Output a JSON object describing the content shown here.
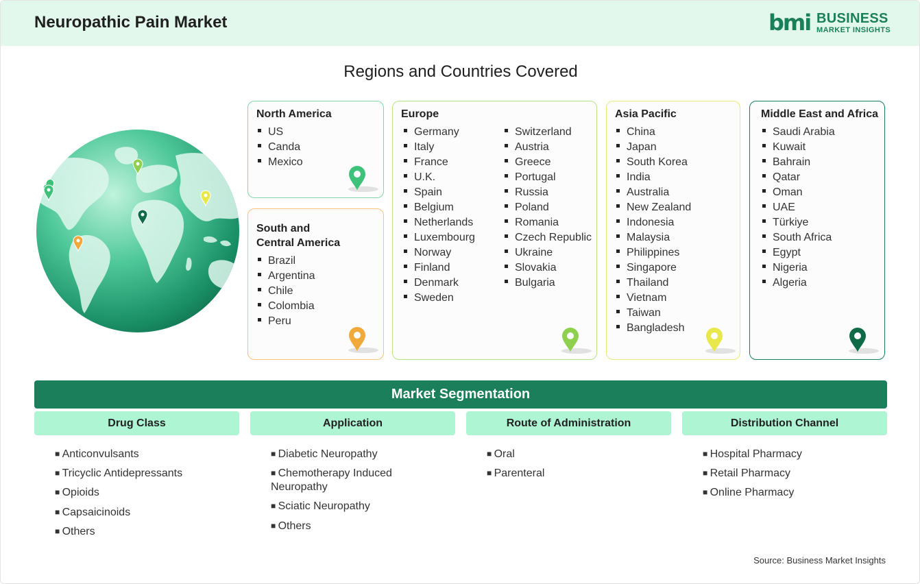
{
  "header": {
    "title": "Neuropathic Pain Market",
    "logo": {
      "mark": "bmi",
      "line1": "BUSINESS",
      "line2": "MARKET INSIGHTS"
    }
  },
  "regions": {
    "title": "Regions and Countries Covered",
    "north_america": {
      "name": "North America",
      "countries": [
        "US",
        "Canda",
        "Mexico"
      ],
      "color": "#3ec27a"
    },
    "south_central_america": {
      "name_line1": "South and",
      "name_line2": "Central America",
      "countries": [
        "Brazil",
        "Argentina",
        "Chile",
        "Colombia",
        "Peru"
      ],
      "color": "#f2a93b"
    },
    "europe": {
      "name": "Europe",
      "countries_col1": [
        "Germany",
        "Italy",
        "France",
        "U.K.",
        "Spain",
        "Belgium",
        "Netherlands",
        "Luxembourg",
        "Norway",
        "Finland",
        "Denmark",
        "Sweden"
      ],
      "countries_col2": [
        "Switzerland",
        "Austria",
        "Greece",
        "Portugal",
        "Russia",
        "Poland",
        "Romania",
        "Czech Republic",
        "Ukraine",
        "Slovakia",
        "Bulgaria"
      ],
      "color": "#8fd14f"
    },
    "asia_pacific": {
      "name": "Asia Pacific",
      "countries": [
        "China",
        "Japan",
        "South Korea",
        "India",
        "Australia",
        "New Zealand",
        "Indonesia",
        "Malaysia",
        "Philippines",
        "Singapore",
        "Thailand",
        "Vietnam",
        "Taiwan",
        "Bangladesh"
      ],
      "color": "#e8e84a"
    },
    "middle_east_africa": {
      "name": "Middle East and Africa",
      "countries": [
        "Saudi Arabia",
        "Kuwait",
        "Bahrain",
        "Qatar",
        "Oman",
        "UAE",
        "Türkiye",
        "South Africa",
        "Egypt",
        "Nigeria",
        "Algeria"
      ],
      "color": "#1a7f5a"
    }
  },
  "segmentation": {
    "title": "Market Segmentation",
    "columns": [
      {
        "head": "Drug Class",
        "items": [
          "Anticonvulsants",
          "Tricyclic Antidepressants",
          "Opioids",
          "Capsaicinoids",
          "Others"
        ]
      },
      {
        "head": "Application",
        "items": [
          "Diabetic Neuropathy",
          "Chemotherapy Induced Neuropathy",
          "Sciatic Neuropathy",
          "Others"
        ]
      },
      {
        "head": "Route of Administration",
        "items": [
          "Oral",
          "Parenteral"
        ]
      },
      {
        "head": "Distribution Channel",
        "items": [
          "Hospital Pharmacy",
          "Retail Pharmacy",
          "Online Pharmacy"
        ]
      }
    ]
  },
  "source": "Source: Business Market Insights",
  "colors": {
    "brand": "#1a7f5a",
    "header_bg": "#e3f8ec",
    "seg_head_bg": "#aef5d4"
  }
}
